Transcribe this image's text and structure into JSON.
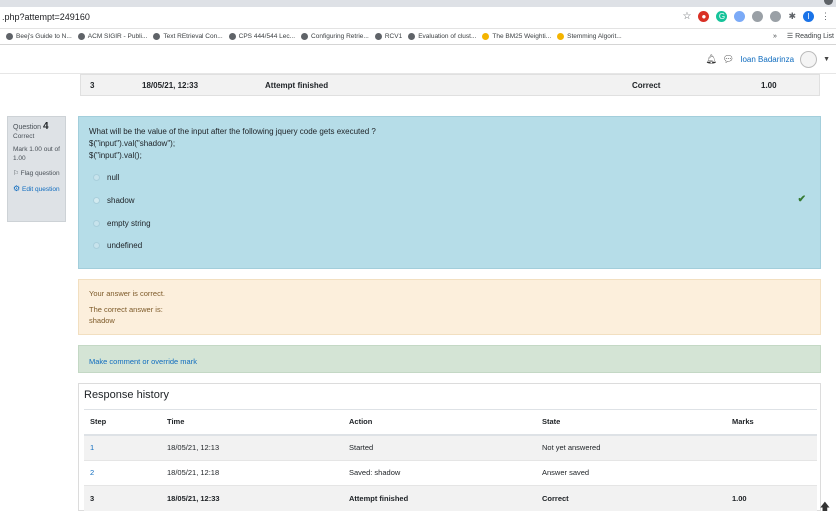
{
  "browser": {
    "url": ".php?attempt=249160",
    "bookmarks": [
      "Beej's Guide to N...",
      "ACM SIGIR - Publi...",
      "Text REtrieval Con...",
      "CPS 444/544 Lec...",
      "Configuring Retrie...",
      "RCV1",
      "Evaluation of clust...",
      "The BM25 Weighti...",
      "Stemming Algorit..."
    ],
    "more": "»",
    "reading_list": "Reading List"
  },
  "header": {
    "user_name": "Ioan Badarinza"
  },
  "top_row": {
    "step": "3",
    "time": "18/05/21, 12:33",
    "action": "Attempt finished",
    "state": "Correct",
    "marks": "1.00"
  },
  "question_info": {
    "label": "Question",
    "number": "4",
    "status": "Correct",
    "mark": "Mark 1.00 out of 1.00",
    "flag": "Flag question",
    "edit": "Edit question"
  },
  "question": {
    "line1": "What will be the value of the input after the following jquery code gets executed ?",
    "line2": "$(\"input\").val(\"shadow\");",
    "line3": "$(\"input\").val();",
    "options": [
      "null",
      "shadow",
      "empty string",
      "undefined"
    ]
  },
  "outcome": {
    "feedback": "Your answer is correct.",
    "right_label": "The correct answer is:",
    "right_answer": "shadow"
  },
  "comment_link": "Make comment or override mark",
  "history": {
    "title": "Response history",
    "headers": [
      "Step",
      "Time",
      "Action",
      "State",
      "Marks"
    ],
    "rows": [
      {
        "step": "1",
        "time": "18/05/21, 12:13",
        "action": "Started",
        "state": "Not yet answered",
        "marks": ""
      },
      {
        "step": "2",
        "time": "18/05/21, 12:18",
        "action": "Saved: shadow",
        "state": "Answer saved",
        "marks": ""
      },
      {
        "step": "3",
        "time": "18/05/21, 12:33",
        "action": "Attempt finished",
        "state": "Correct",
        "marks": "1.00"
      }
    ]
  },
  "colors": {
    "link": "#0f6cbf",
    "formulation_bg": "#b6dde8",
    "outcome_bg": "#fcefdc",
    "comment_bg": "#d4e4d5",
    "correct": "#357a32"
  }
}
